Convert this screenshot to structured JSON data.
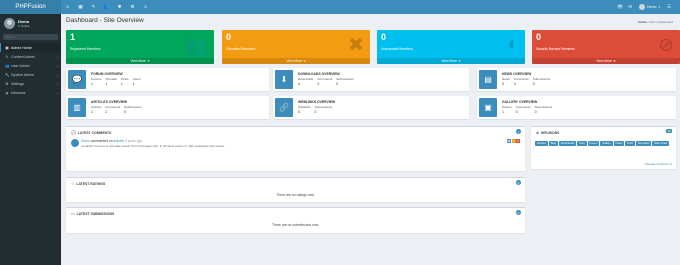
{
  "brand": "PHPFusion",
  "user": {
    "name": "Demo",
    "status": "Online"
  },
  "sidebar": {
    "search_placeholder": "Search...",
    "items": [
      {
        "label": "Admin Home",
        "icon": "dashboard-icon",
        "active": true,
        "chevron": false
      },
      {
        "label": "Content Admin",
        "icon": "pencil-icon",
        "active": false,
        "chevron": true
      },
      {
        "label": "User Admin",
        "icon": "users-icon",
        "active": false,
        "chevron": true
      },
      {
        "label": "System Admin",
        "icon": "wrench-icon",
        "active": false,
        "chevron": true
      },
      {
        "label": "Settings",
        "icon": "gear-icon",
        "active": false,
        "chevron": true
      },
      {
        "label": "Infusions",
        "icon": "cubes-icon",
        "active": false,
        "chevron": true
      }
    ]
  },
  "topbar": {
    "icons": [
      "menu-icon",
      "dashboard-icon",
      "content-icon",
      "users-icon",
      "system-icon",
      "settings-icon",
      "warning-icon"
    ],
    "account_name": "Demo"
  },
  "page": {
    "title": "Dashboard - Site Overview",
    "breadcrumb_home": "Home",
    "breadcrumb_current": "Admin Dashboard"
  },
  "boxes": [
    {
      "value": "1",
      "label": "Registered Members",
      "link": "View More",
      "color": "#00a65a",
      "icon": "users-icon"
    },
    {
      "value": "0",
      "label": "Cancelled Members",
      "link": "View More",
      "color": "#f39c12",
      "icon": "user-times-icon"
    },
    {
      "value": "0",
      "label": "Unactivated Members",
      "link": "View More",
      "color": "#00c0ef",
      "icon": "user-secret-icon"
    },
    {
      "value": "0",
      "label": "Security Banned Members",
      "link": "View More",
      "color": "#dd4b39",
      "icon": "user-ban-icon"
    }
  ],
  "overviews": [
    {
      "title": "FORUM OVERVIEW",
      "icon": "comments-icon",
      "stats": [
        {
          "k": "Forums",
          "v": "1"
        },
        {
          "k": "Threads",
          "v": "1"
        },
        {
          "k": "Posts",
          "v": "1"
        },
        {
          "k": "Users",
          "v": "1"
        }
      ]
    },
    {
      "title": "DOWNLOADS OVERVIEW",
      "icon": "download-icon",
      "stats": [
        {
          "k": "Downloads",
          "v": "4"
        },
        {
          "k": "Comments",
          "v": "0"
        },
        {
          "k": "Submissions",
          "v": "0"
        }
      ]
    },
    {
      "title": "NEWS OVERVIEW",
      "icon": "newspaper-icon",
      "stats": [
        {
          "k": "News",
          "v": "3"
        },
        {
          "k": "Comments",
          "v": "0"
        },
        {
          "k": "Submissions",
          "v": "0"
        }
      ]
    },
    {
      "title": "ARTICLES OVERVIEW",
      "icon": "book-icon",
      "stats": [
        {
          "k": "Articles",
          "v": "1"
        },
        {
          "k": "Comments",
          "v": "1"
        },
        {
          "k": "Submissions",
          "v": "0"
        }
      ]
    },
    {
      "title": "WEBLINKS OVERVIEW",
      "icon": "link-icon",
      "stats": [
        {
          "k": "Weblinks",
          "v": "5"
        },
        {
          "k": "Submissions",
          "v": "0"
        }
      ]
    },
    {
      "title": "GALLERY OVERVIEW",
      "icon": "image-icon",
      "stats": [
        {
          "k": "Photos",
          "v": "1"
        },
        {
          "k": "Comments",
          "v": "0"
        },
        {
          "k": "Submissions",
          "v": "0"
        }
      ]
    }
  ],
  "comments": {
    "title": "LATEST COMMENTS",
    "count": "1",
    "author": "Demo",
    "action": "commented on",
    "target": "Articles",
    "time": "5 years ago",
    "text": "Curabitur rhoncus et nisl vitae iaculis. Proin id feugiat nibh. In tincidunt purus mi, nibh vestibulum fermentum."
  },
  "ratings": {
    "title": "LATEST RATINGS",
    "count": "0",
    "empty": "There are no ratings now."
  },
  "submissions": {
    "title": "LATEST SUBMISSIONS",
    "count": "0",
    "empty": "There are no submissions now."
  },
  "infusions": {
    "title": "INFUSIONS",
    "count": "10",
    "tags": [
      "Articles",
      "Blog",
      "Downloads",
      "FAQ",
      "Forum",
      "Gallery",
      "News",
      "Polls",
      "Shoutbox",
      "Web Links"
    ],
    "manage_link": "Manage Infusions"
  }
}
